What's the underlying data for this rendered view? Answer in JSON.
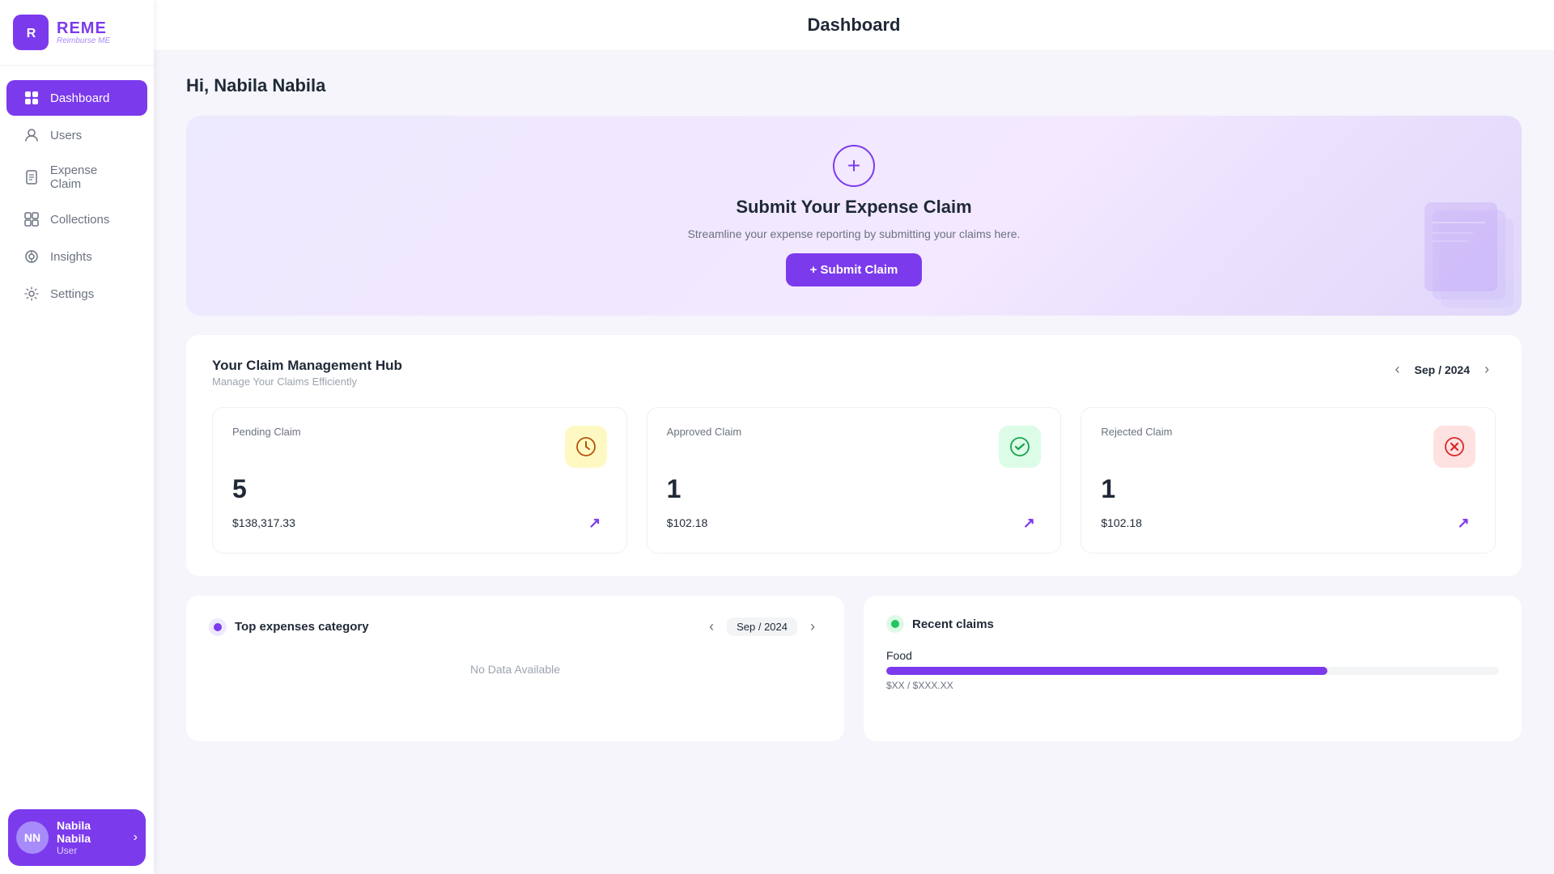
{
  "app": {
    "name": "REME",
    "tagline": "Reimburse ME",
    "logo_initials": "R"
  },
  "sidebar": {
    "nav_items": [
      {
        "id": "dashboard",
        "label": "Dashboard",
        "icon": "⊞",
        "active": true
      },
      {
        "id": "users",
        "label": "Users",
        "icon": "👤",
        "active": false
      },
      {
        "id": "expense-claim",
        "label": "Expense Claim",
        "icon": "🧾",
        "active": false
      },
      {
        "id": "collections",
        "label": "Collections",
        "icon": "⊡",
        "active": false
      },
      {
        "id": "insights",
        "label": "Insights",
        "icon": "◎",
        "active": false
      },
      {
        "id": "settings",
        "label": "Settings",
        "icon": "⚙",
        "active": false
      }
    ],
    "user": {
      "name": "Nabila Nabila",
      "initials": "NN",
      "role": "User"
    }
  },
  "header": {
    "title": "Dashboard"
  },
  "greeting": "Hi, Nabila Nabila",
  "banner": {
    "title": "Submit Your Expense Claim",
    "description": "Streamline your expense reporting by submitting your claims here.",
    "button_label": "+ Submit Claim"
  },
  "claim_hub": {
    "title": "Your Claim Management Hub",
    "subtitle": "Manage Your Claims Efficiently",
    "month": "Sep / 2024",
    "cards": [
      {
        "label": "Pending Claim",
        "count": "5",
        "amount": "$138,317.33",
        "icon_type": "yellow",
        "icon": "⊘"
      },
      {
        "label": "Approved Claim",
        "count": "1",
        "amount": "$102.18",
        "icon_type": "green",
        "icon": "✔"
      },
      {
        "label": "Rejected Claim",
        "count": "1",
        "amount": "$102.18",
        "icon_type": "red",
        "icon": "⊘"
      }
    ]
  },
  "top_expenses": {
    "title": "Top expenses category",
    "month": "Sep / 2024",
    "no_data": "No Data Available"
  },
  "recent_claims": {
    "title": "Recent claims",
    "items": [
      {
        "label": "Food",
        "progress": 72,
        "amount": "$XX / $XXX.XX"
      }
    ]
  },
  "colors": {
    "primary": "#7c3aed",
    "primary_light": "#ede9fe",
    "yellow_bg": "#fef9c3",
    "green_bg": "#dcfce7",
    "red_bg": "#fee2e2"
  }
}
